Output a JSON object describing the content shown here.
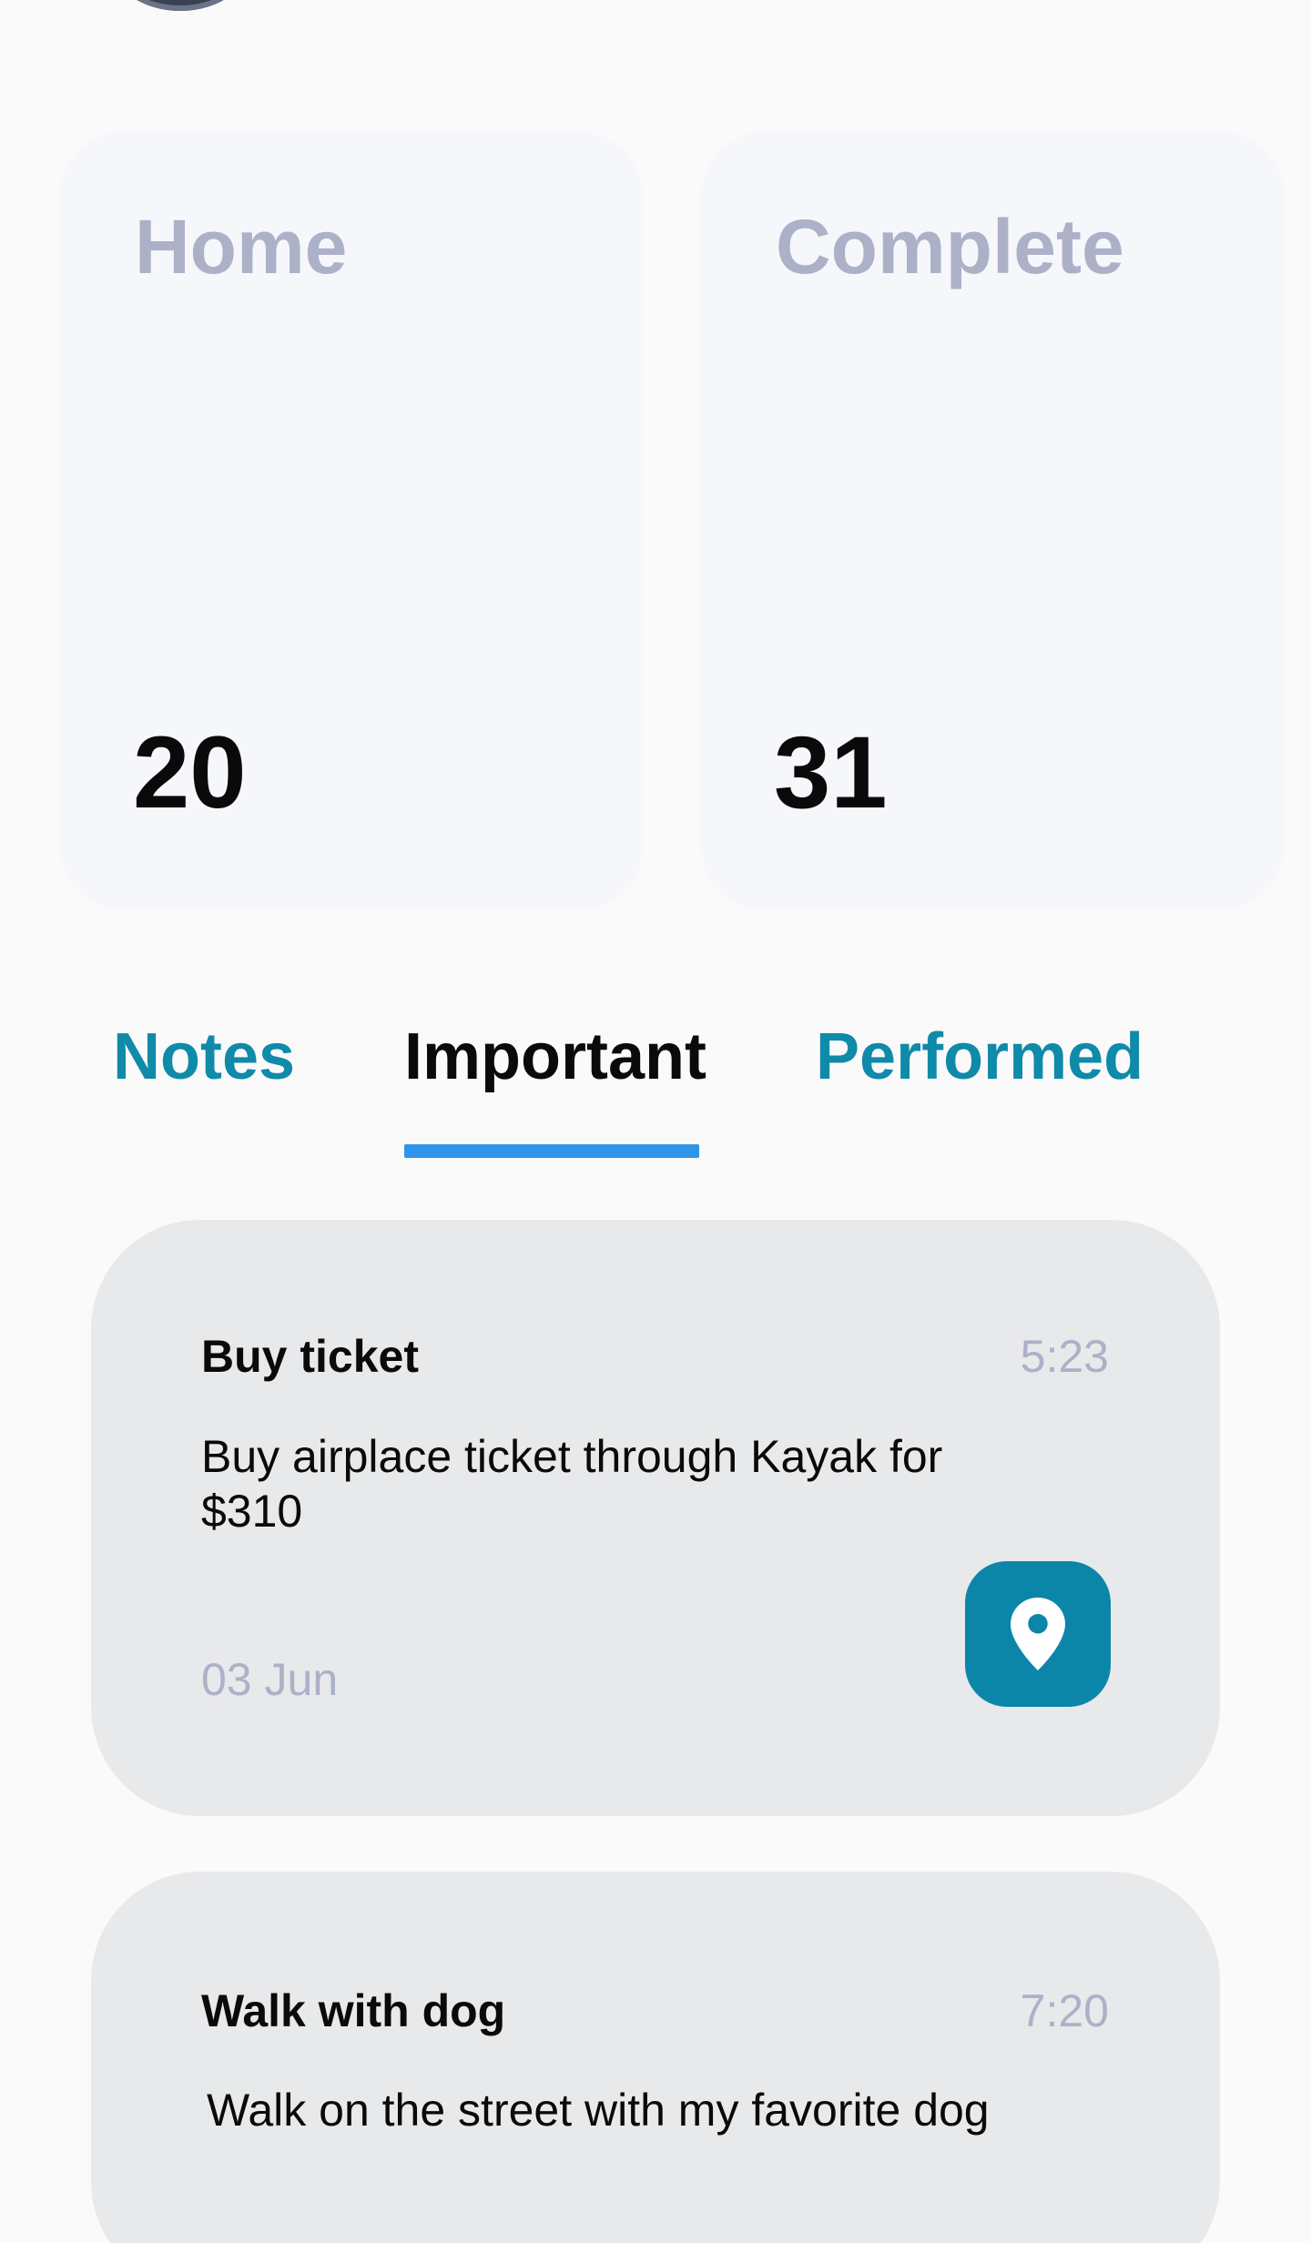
{
  "stats": [
    {
      "label": "Home",
      "value": "20"
    },
    {
      "label": "Complete",
      "value": "31"
    }
  ],
  "tabs": {
    "items": [
      "Notes",
      "Important",
      "Performed"
    ],
    "active_index": 1
  },
  "notes": [
    {
      "title": "Buy ticket",
      "time": "5:23",
      "body": "Buy airplace ticket through Kayak for $310",
      "date": "03 Jun",
      "action_icon": "location-pin-icon"
    },
    {
      "title": "Walk with dog",
      "time": "7:20",
      "body": "Walk on the street with my favorite dog"
    }
  ],
  "colors": {
    "background": "#fafafa",
    "stat_card": "#f5f7fb",
    "note_card": "#e8e9eb",
    "muted_text": "#adb1c8",
    "accent_teal": "#108aa9",
    "tab_indicator": "#2e95ea",
    "primary_text": "#0a0a0a"
  }
}
